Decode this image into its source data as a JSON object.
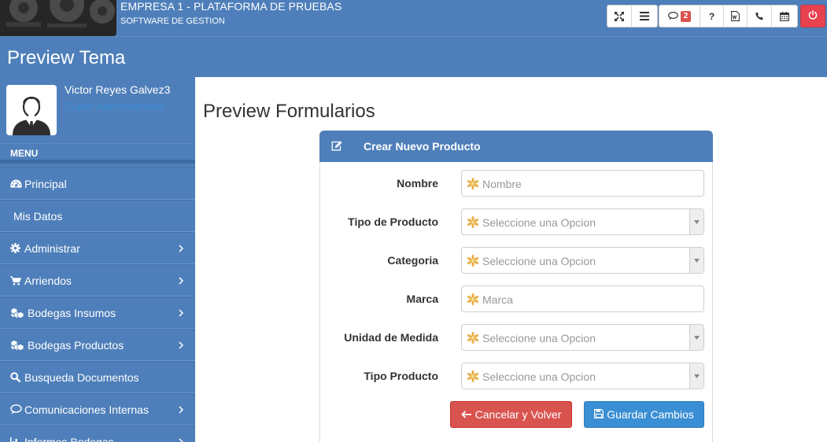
{
  "header": {
    "company": "EMPRESA 1 - PLATAFORMA DE PRUEBAS",
    "subtitle": "SOFTWARE DE GESTION",
    "toolbar": {
      "icons": [
        "expand-icon",
        "list-icon",
        "comment-icon",
        "question-icon",
        "word-file-icon",
        "phone-icon",
        "calendar-icon",
        "power-icon"
      ],
      "messages_count": "2",
      "help_label": "?"
    }
  },
  "page": {
    "title": "Preview Tema"
  },
  "sidebar": {
    "user_name": "Victor Reyes Galvez3",
    "user_role": "Super Administrador",
    "menu_heading": "MENU",
    "items": [
      {
        "label": "Principal",
        "icon": "dashboard-icon",
        "has_children": false
      },
      {
        "label": "Mis Datos",
        "icon": "",
        "has_children": false
      },
      {
        "label": "Administrar",
        "icon": "gear-icon",
        "has_children": true
      },
      {
        "label": "Arriendos",
        "icon": "cart-icon",
        "has_children": true
      },
      {
        "label": "Bodegas Insumos",
        "icon": "cubes-icon",
        "has_children": true
      },
      {
        "label": "Bodegas Productos",
        "icon": "cubes-icon",
        "has_children": true
      },
      {
        "label": "Busqueda Documentos",
        "icon": "search-icon",
        "has_children": false
      },
      {
        "label": "Comunicaciones Internas",
        "icon": "comment-icon",
        "has_children": true
      },
      {
        "label": "Informes Bodegas",
        "icon": "bar-chart-icon",
        "has_children": true
      }
    ]
  },
  "main": {
    "title": "Preview Formularios",
    "panel_title": "Crear Nuevo Producto",
    "fields": [
      {
        "label": "Nombre",
        "type": "text",
        "placeholder": "Nombre"
      },
      {
        "label": "Tipo de Producto",
        "type": "select",
        "placeholder": "Seleccione una Opcion"
      },
      {
        "label": "Categoria",
        "type": "select",
        "placeholder": "Seleccione una Opcion"
      },
      {
        "label": "Marca",
        "type": "text",
        "placeholder": "Marca"
      },
      {
        "label": "Unidad de Medida",
        "type": "select",
        "placeholder": "Seleccione una Opcion"
      },
      {
        "label": "Tipo Producto",
        "type": "select",
        "placeholder": "Seleccione una Opcion"
      }
    ],
    "cancel_label": "Cancelar y Volver",
    "save_label": "Guardar Cambios"
  },
  "colors": {
    "primary": "#4e7fba",
    "danger": "#d9534f",
    "save": "#3a8fd4",
    "power": "#e8424f",
    "role_text": "#3c8dd6"
  }
}
